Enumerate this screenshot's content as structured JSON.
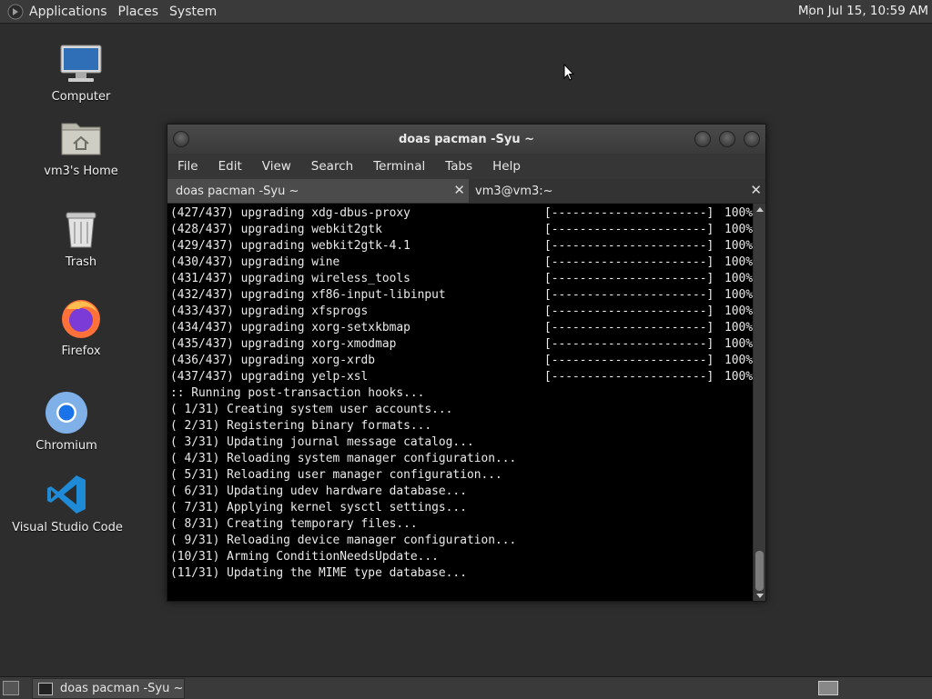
{
  "top_panel": {
    "menus": [
      "Applications",
      "Places",
      "System"
    ],
    "clock": "Mon Jul 15, 10:59 AM"
  },
  "desktop_icons": [
    {
      "label": "Computer",
      "icon": "computer-icon"
    },
    {
      "label": "vm3's Home",
      "icon": "home-folder-icon"
    },
    {
      "label": "Trash",
      "icon": "trash-icon"
    },
    {
      "label": "Firefox",
      "icon": "firefox-icon"
    },
    {
      "label": "Chromium",
      "icon": "chromium-icon"
    },
    {
      "label": "Visual Studio Code",
      "icon": "vscode-icon"
    }
  ],
  "terminal": {
    "title": "doas pacman -Syu ~",
    "menus": [
      "File",
      "Edit",
      "View",
      "Search",
      "Terminal",
      "Tabs",
      "Help"
    ],
    "tabs": [
      {
        "label": "doas pacman -Syu ~",
        "active": true
      },
      {
        "label": "vm3@vm3:~",
        "active": false
      }
    ],
    "progress_bar": "[----------------------]",
    "upgrade_lines": [
      {
        "text": "(427/437) upgrading xdg-dbus-proxy",
        "percent": "100%"
      },
      {
        "text": "(428/437) upgrading webkit2gtk",
        "percent": "100%"
      },
      {
        "text": "(429/437) upgrading webkit2gtk-4.1",
        "percent": "100%"
      },
      {
        "text": "(430/437) upgrading wine",
        "percent": "100%"
      },
      {
        "text": "(431/437) upgrading wireless_tools",
        "percent": "100%"
      },
      {
        "text": "(432/437) upgrading xf86-input-libinput",
        "percent": "100%"
      },
      {
        "text": "(433/437) upgrading xfsprogs",
        "percent": "100%"
      },
      {
        "text": "(434/437) upgrading xorg-setxkbmap",
        "percent": "100%"
      },
      {
        "text": "(435/437) upgrading xorg-xmodmap",
        "percent": "100%"
      },
      {
        "text": "(436/437) upgrading xorg-xrdb",
        "percent": "100%"
      },
      {
        "text": "(437/437) upgrading yelp-xsl",
        "percent": "100%"
      }
    ],
    "hook_lines": [
      ":: Running post-transaction hooks...",
      "( 1/31) Creating system user accounts...",
      "( 2/31) Registering binary formats...",
      "( 3/31) Updating journal message catalog...",
      "( 4/31) Reloading system manager configuration...",
      "( 5/31) Reloading user manager configuration...",
      "( 6/31) Updating udev hardware database...",
      "( 7/31) Applying kernel sysctl settings...",
      "( 8/31) Creating temporary files...",
      "( 9/31) Reloading device manager configuration...",
      "(10/31) Arming ConditionNeedsUpdate...",
      "(11/31) Updating the MIME type database..."
    ]
  },
  "taskbar": {
    "task_label": "doas pacman -Syu ~"
  }
}
